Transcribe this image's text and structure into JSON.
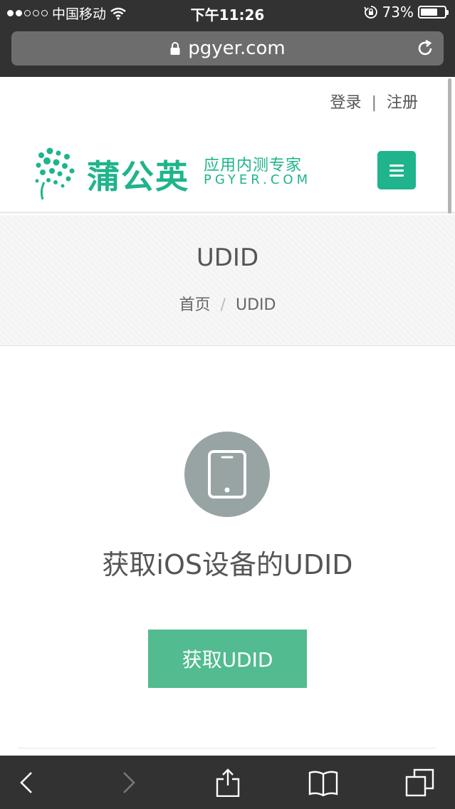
{
  "status_bar": {
    "carrier": "中国移动",
    "time": "下午11:26",
    "battery_percent": "73%",
    "battery_level": 0.73,
    "signal_bars_filled": 2,
    "signal_bars_total": 5
  },
  "browser": {
    "url": "pgyer.com"
  },
  "header": {
    "login_label": "登录",
    "separator": "|",
    "register_label": "注册"
  },
  "logo": {
    "title": "蒲公英",
    "slogan": "应用内测专家",
    "domain": "PGYER.COM"
  },
  "page": {
    "title": "UDID",
    "breadcrumb": {
      "home": "首页",
      "separator": "/",
      "current": "UDID"
    }
  },
  "main": {
    "icon": "tablet-icon",
    "heading": "获取iOS设备的UDID",
    "button_label": "获取UDID"
  },
  "colors": {
    "brand": "#1fb48c",
    "button": "#52bb8f",
    "icon_circle": "#98a3a3",
    "chrome": "#323232"
  },
  "toolbar": {
    "icons": [
      "back-icon",
      "forward-icon",
      "share-icon",
      "bookmarks-icon",
      "tabs-icon"
    ]
  }
}
